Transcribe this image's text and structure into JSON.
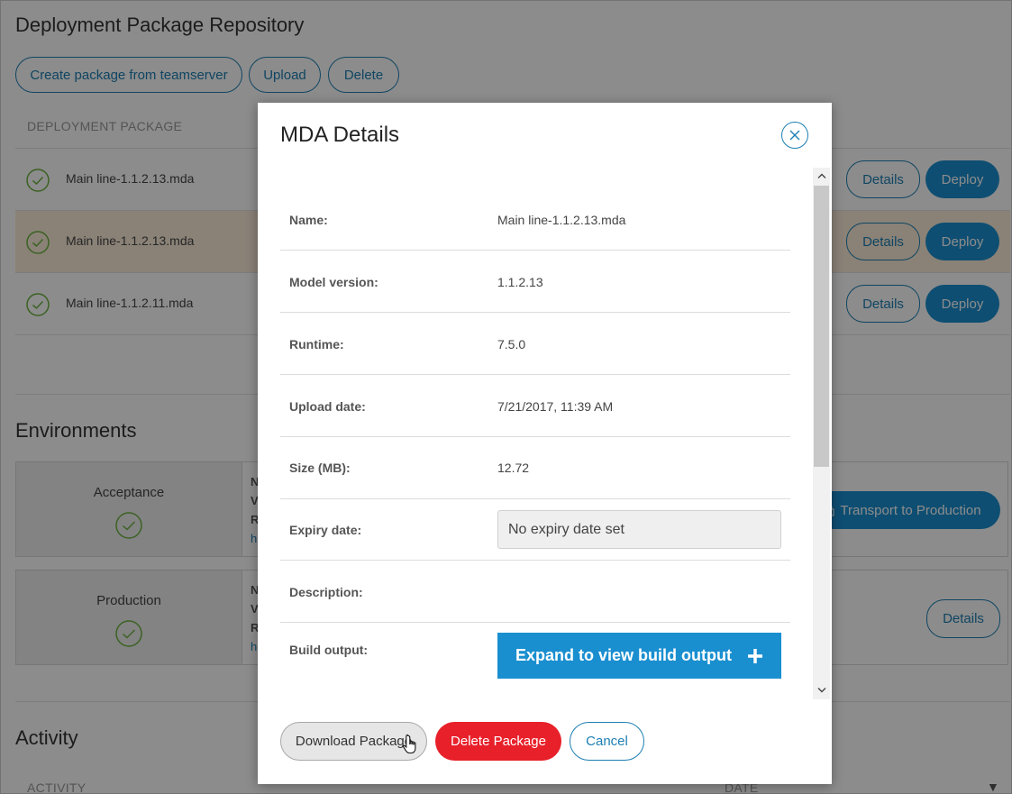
{
  "page": {
    "title": "Deployment Package Repository",
    "buttons": {
      "create": "Create package from teamserver",
      "upload": "Upload",
      "delete": "Delete"
    },
    "column_header": "DEPLOYMENT PACKAGE",
    "packages": [
      {
        "name": "Main line-1.1.2.13.mda",
        "details": "Details",
        "deploy": "Deploy"
      },
      {
        "name": "Main line-1.1.2.13.mda",
        "details": "Details",
        "deploy": "Deploy"
      },
      {
        "name": "Main line-1.1.2.11.mda",
        "details": "Details",
        "deploy": "Deploy"
      }
    ]
  },
  "environments": {
    "title": "Environments",
    "items": [
      {
        "name": "Acceptance",
        "info": [
          "N",
          "V",
          "R"
        ],
        "link": "h",
        "action": "Transport to Production"
      },
      {
        "name": "Production",
        "info": [
          "N",
          "V",
          "R"
        ],
        "link": "h",
        "action": "Details"
      }
    ]
  },
  "activity": {
    "title": "Activity",
    "col_activity": "ACTIVITY",
    "col_date": "DATE",
    "sort_icon": "▼"
  },
  "modal": {
    "title": "MDA Details",
    "rows": {
      "name": {
        "label": "Name:",
        "value": "Main line-1.1.2.13.mda"
      },
      "model_version": {
        "label": "Model version:",
        "value": "1.1.2.13"
      },
      "runtime": {
        "label": "Runtime:",
        "value": "7.5.0"
      },
      "upload_date": {
        "label": "Upload date:",
        "value": "7/21/2017, 11:39 AM"
      },
      "size": {
        "label": "Size (MB):",
        "value": "12.72"
      },
      "expiry": {
        "label": "Expiry date:",
        "value": "No expiry date set"
      },
      "description": {
        "label": "Description:",
        "value": ""
      },
      "build_output": {
        "label": "Build output:",
        "button": "Expand to view build output"
      }
    },
    "footer": {
      "download": "Download Package",
      "delete": "Delete Package",
      "cancel": "Cancel"
    }
  },
  "colors": {
    "accent": "#1d7fb3",
    "primary_button": "#1a8fd0",
    "danger": "#e8202a",
    "success": "#6cb33f",
    "selected_row": "#fbedd9"
  }
}
